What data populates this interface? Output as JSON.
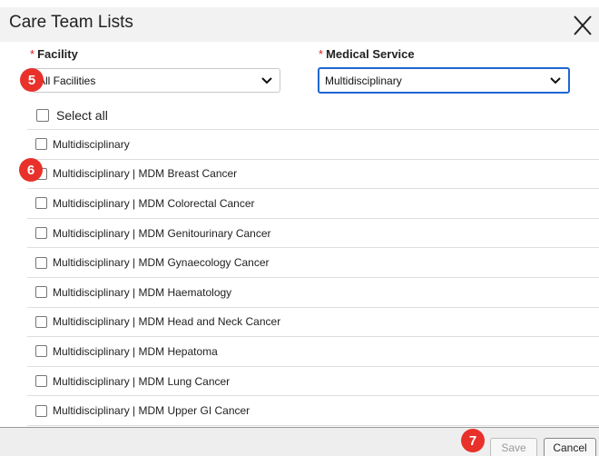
{
  "dialog": {
    "title": "Care Team Lists",
    "close_icon": "close-icon"
  },
  "facility": {
    "required_mark": "*",
    "label": "Facility",
    "selected": "All Facilities"
  },
  "service": {
    "required_mark": "*",
    "label": "Medical Service",
    "selected": "Multidisciplinary"
  },
  "badges": [
    "5",
    "6",
    "7"
  ],
  "select_all_label": "Select all",
  "items": [
    "Multidisciplinary",
    "Multidisciplinary | MDM Breast Cancer",
    "Multidisciplinary | MDM Colorectal Cancer",
    "Multidisciplinary | MDM Genitourinary Cancer",
    "Multidisciplinary | MDM Gynaecology Cancer",
    "Multidisciplinary | MDM Haematology",
    "Multidisciplinary | MDM Head and Neck Cancer",
    "Multidisciplinary | MDM Hepatoma",
    "Multidisciplinary | MDM Lung Cancer",
    "Multidisciplinary | MDM Upper GI Cancer"
  ],
  "footer": {
    "save_label": "Save",
    "cancel_label": "Cancel"
  },
  "colors": {
    "badge": "#e8312a",
    "focus_border": "#1e66d0",
    "required": "#e02020"
  }
}
